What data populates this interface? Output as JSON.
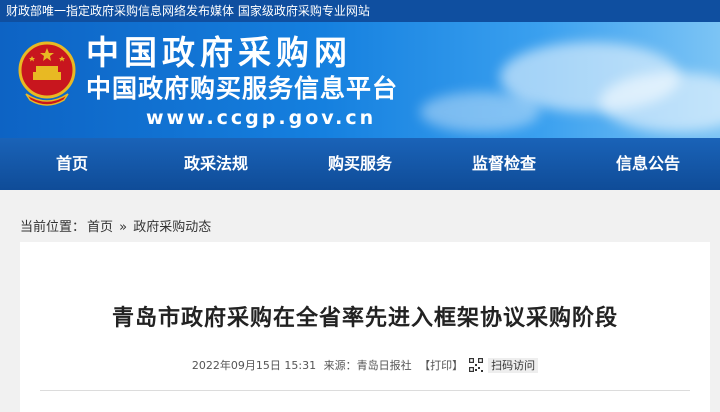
{
  "topbar": {
    "text": "财政部唯一指定政府采购信息网络发布媒体 国家级政府采购专业网站"
  },
  "banner": {
    "title": "中国政府采购网",
    "subtitle": "中国政府购买服务信息平台",
    "url": "www.ccgp.gov.cn"
  },
  "nav": [
    "首页",
    "政采法规",
    "购买服务",
    "监督检查",
    "信息公告"
  ],
  "breadcrumb": {
    "label": "当前位置：",
    "home": "首页",
    "sep": "»",
    "section": "政府采购动态"
  },
  "article": {
    "title": "青岛市政府采购在全省率先进入框架协议采购阶段",
    "datetime": "2022年09月15日 15:31",
    "source": "来源：青岛日报社",
    "print": "【打印】",
    "scan": "扫码访问"
  },
  "colors": {
    "topbar": "#0f4fa0",
    "nav": "#1a63b8",
    "banner": "#1580df"
  }
}
